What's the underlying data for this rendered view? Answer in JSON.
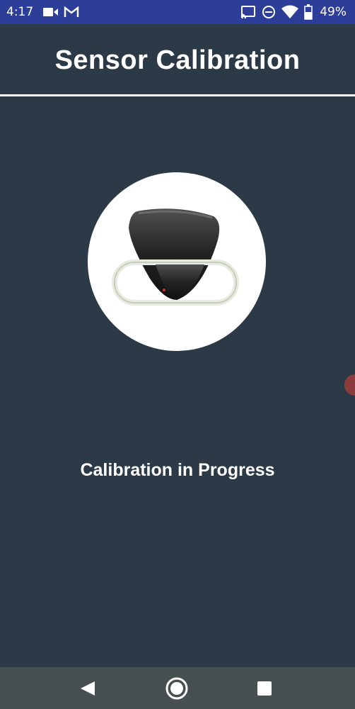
{
  "status_bar": {
    "time": "4:17",
    "battery": "49%",
    "icons": [
      "camera-icon",
      "gmail-icon",
      "cast-icon",
      "do-not-disturb-icon",
      "wifi-icon",
      "battery-icon"
    ]
  },
  "header": {
    "title": "Sensor Calibration"
  },
  "main": {
    "status_text": "Calibration in Progress"
  },
  "nav_bar": {
    "icons": [
      "back-icon",
      "home-icon",
      "recents-icon"
    ]
  },
  "colors": {
    "background": "#2c3a47",
    "status_bar": "#2d3e99",
    "nav_bar": "#465050",
    "text": "#ffffff"
  }
}
